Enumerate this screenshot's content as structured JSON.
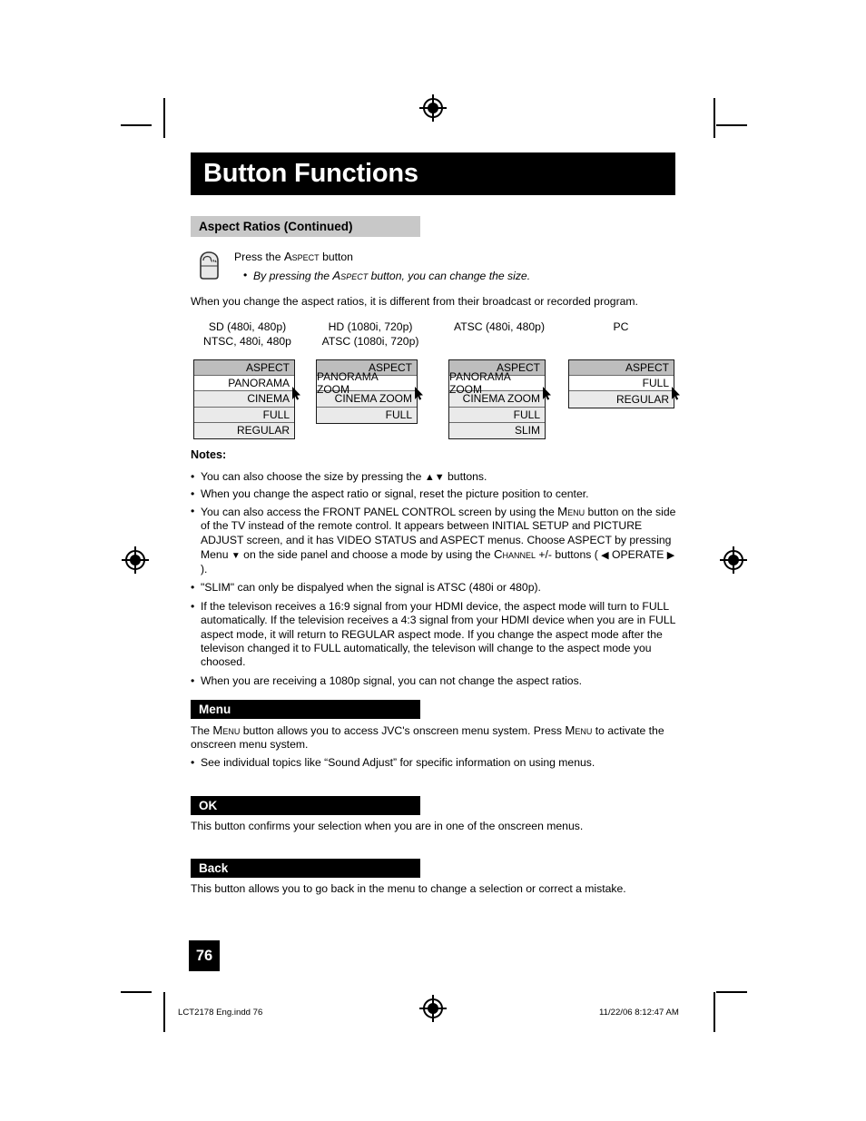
{
  "document": {
    "title": "Button Functions",
    "page_number": "76"
  },
  "aspect_section": {
    "heading": "Aspect Ratios (Continued)",
    "press_line_pre": "Press the ",
    "press_line_sc": "Aspect",
    "press_line_post": " button",
    "press_bullet_pre": "By pressing the ",
    "press_bullet_sc": "Aspect",
    "press_bullet_post": " button, you can change the size.",
    "intro": "When you change the aspect ratios, it is different from their broadcast or recorded program."
  },
  "tables": [
    {
      "label_line1": "SD (480i, 480p)",
      "label_line2": "NTSC, 480i, 480p",
      "header": "ASPECT",
      "rows": [
        "PANORAMA",
        "CINEMA",
        "FULL",
        "REGULAR"
      ],
      "white_row_index": 0
    },
    {
      "label_line1": "HD (1080i, 720p)",
      "label_line2": "ATSC (1080i, 720p)",
      "header": "ASPECT",
      "rows": [
        "PANORAMA ZOOM",
        "CINEMA ZOOM",
        "FULL"
      ],
      "white_row_index": 0
    },
    {
      "label_line1": "ATSC (480i, 480p)",
      "label_line2": "",
      "header": "ASPECT",
      "rows": [
        "PANORAMA ZOOM",
        "CINEMA ZOOM",
        "FULL",
        "SLIM"
      ],
      "white_row_index": 0
    },
    {
      "label_line1": "PC",
      "label_line2": "",
      "header": "ASPECT",
      "rows": [
        "FULL",
        "REGULAR"
      ],
      "white_row_index": 0
    }
  ],
  "notes": {
    "heading": "Notes:",
    "items": [
      {
        "pre": "You can also choose the size by pressing the ",
        "glyph": "▲▼",
        "post": "  buttons."
      },
      {
        "pre": "When you change the aspect ratio or signal, reset the picture position to center.",
        "glyph": "",
        "post": ""
      },
      {
        "pre": "You can also access the FRONT PANEL CONTROL screen by using the ",
        "sc1": "Menu",
        "mid1": " button on the side of the TV instead of the remote control.  It appears between INITIAL SETUP and PICTURE ADJUST screen, and it has VIDEO STATUS and ASPECT menus. Choose ASPECT by pressing Menu ",
        "glyph1": "▼",
        "mid2": " on the side panel and choose a mode by using the ",
        "sc2": "Channel",
        "mid3": " +/- buttons ( ",
        "glyph2": "◀",
        "mid4": " OPERATE ",
        "glyph3": "▶",
        "post": " )."
      },
      {
        "pre": "\"SLIM\" can only be dispalyed when the signal is ATSC (480i or 480p).",
        "glyph": "",
        "post": ""
      },
      {
        "pre": "If the televison receives a 16:9 signal from your HDMI device, the aspect mode will turn to FULL automatically.  If the television receives a 4:3 signal from your HDMI device when you are in FULL aspect mode, it will return to REGULAR aspect mode.  If you change the aspect mode after the televison changed it to FULL automatically, the televison will change to the aspect mode you choosed.",
        "glyph": "",
        "post": ""
      },
      {
        "pre": "When you are receiving a 1080p signal, you can not change the aspect ratios.",
        "glyph": "",
        "post": ""
      }
    ]
  },
  "menu_section": {
    "heading": "Menu",
    "body_pre": "The ",
    "body_sc1": "Menu",
    "body_mid": " button allows you to access JVC's onscreen menu system. Press ",
    "body_sc2": "Menu",
    "body_post": " to activate the onscreen menu system.",
    "bullet": "See individual topics like “Sound Adjust” for specific information on using menus."
  },
  "ok_section": {
    "heading": "OK",
    "body": "This button confirms your selection when you are in one of the onscreen menus."
  },
  "back_section": {
    "heading": "Back",
    "body": "This button allows you to go back in the menu to change a selection or correct a mistake."
  },
  "footer": {
    "file": "LCT2178 Eng.indd   76",
    "timestamp": "11/22/06   8:12:47 AM"
  },
  "colors": {
    "header_bar": "#000000",
    "section_gray": "#c8c8c8",
    "table_header_gray": "#bdbdbd",
    "table_row_gray": "#eaeaea"
  }
}
